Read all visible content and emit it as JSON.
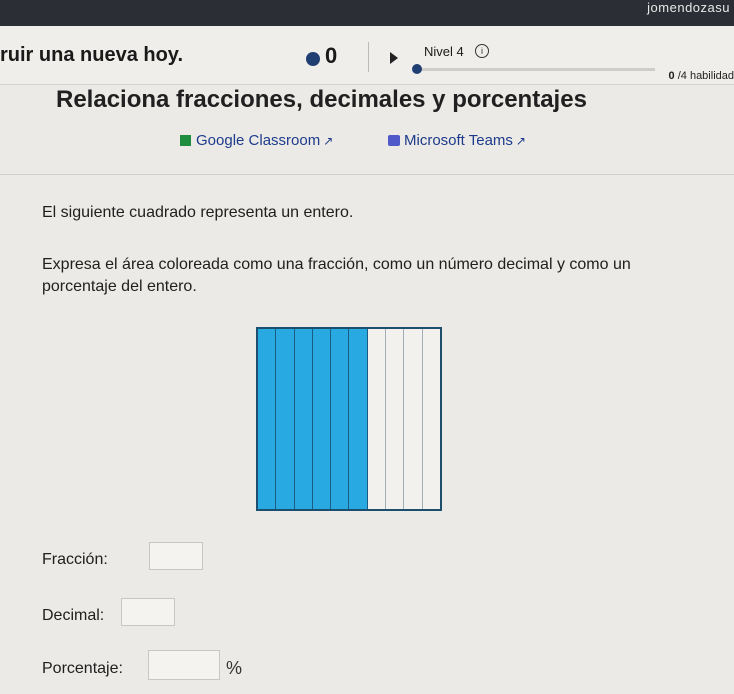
{
  "topbar": {
    "user_name": "jomendozasu"
  },
  "header": {
    "goal_text": "ruir una nueva hoy.",
    "streak_count": "0",
    "level_label": "Nivel 4",
    "skills_count": "0",
    "skills_suffix": "/4 habilidad"
  },
  "page_title": "Relaciona fracciones, decimales y porcentajes",
  "share": {
    "classroom_label": "Google Classroom",
    "teams_label": "Microsoft Teams"
  },
  "prompt": {
    "line1": "El siguiente cuadrado representa un entero.",
    "line2": "Expresa el área coloreada como una fracción, como un número decimal y como un porcentaje del entero."
  },
  "grid": {
    "total_strips": 10,
    "filled_strips": 6,
    "fill_color": "#28a9e1"
  },
  "answers": {
    "fraction_label": "Fracción:",
    "decimal_label": "Decimal:",
    "percent_label": "Porcentaje:",
    "percent_sign": "%",
    "fraction_value": "",
    "decimal_value": "",
    "percent_value": ""
  }
}
